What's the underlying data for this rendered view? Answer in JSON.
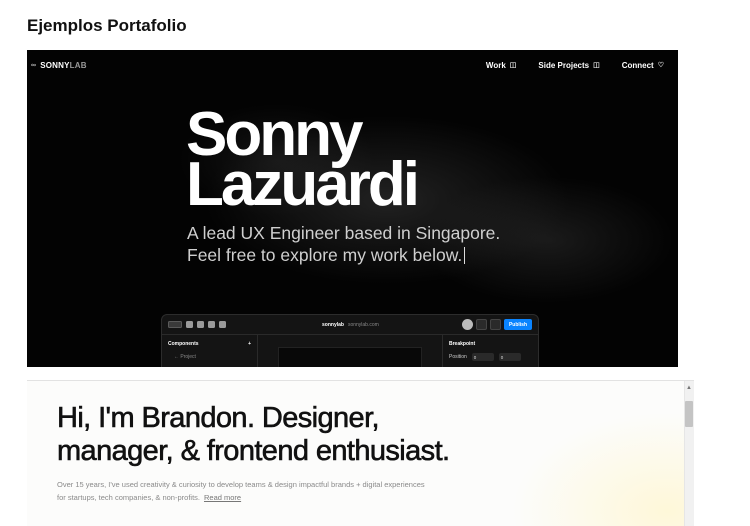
{
  "page": {
    "heading": "Ejemplos Portafolio"
  },
  "example_sonny": {
    "nav": {
      "logo_primary": "SONNY",
      "logo_secondary": "LAB",
      "links": [
        {
          "label": "Work",
          "icon": "briefcase-icon"
        },
        {
          "label": "Side Projects",
          "icon": "lamp-icon"
        },
        {
          "label": "Connect",
          "icon": "heart-icon"
        }
      ]
    },
    "hero": {
      "name_line1": "Sonny",
      "name_line2": "Lazuardi",
      "subtitle_line1": "A lead UX Engineer based in Singapore.",
      "subtitle_line2": "Feel free to explore my work below."
    },
    "editor": {
      "site_name": "sonnylab",
      "site_domain": "sonnylab.com",
      "publish_label": "Publish",
      "left_panel_title": "Components",
      "left_panel_add": "+",
      "left_panel_item": "← Project",
      "right_panel_title": "Breakpoint",
      "right_panel_row_label": "Position",
      "field_value_1": "0",
      "field_value_2": "0"
    }
  },
  "example_brandon": {
    "headline_line1": "Hi, I'm Brandon. Designer,",
    "headline_line2": "manager, & frontend enthusiast.",
    "body_line1": "Over 15 years, I've used creativity & curiosity to develop teams & design impactful brands + digital experiences",
    "body_line2": "for startups, tech companies, & non-profits.",
    "read_more": "Read more"
  }
}
